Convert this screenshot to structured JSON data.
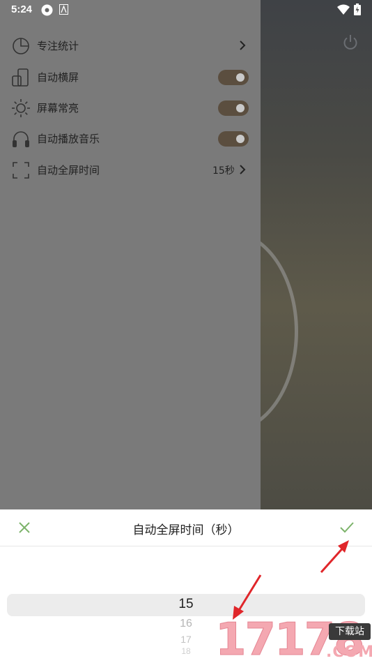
{
  "status_bar": {
    "time": "5:24"
  },
  "menu": {
    "items": [
      {
        "label": "专注统计",
        "icon": "pie-chart-icon",
        "control": "chevron"
      },
      {
        "label": "自动横屏",
        "icon": "rotate-phone-icon",
        "control": "toggle",
        "on": true
      },
      {
        "label": "屏幕常亮",
        "icon": "sun-icon",
        "control": "toggle",
        "on": true
      },
      {
        "label": "自动播放音乐",
        "icon": "headphones-icon",
        "control": "toggle",
        "on": true
      },
      {
        "label": "自动全屏时间",
        "icon": "fullscreen-icon",
        "control": "chevron",
        "value": "15秒"
      }
    ]
  },
  "sheet": {
    "title": "自动全屏时间（秒）",
    "picker": {
      "selected": "15",
      "next": [
        "16",
        "17",
        "18"
      ]
    }
  },
  "watermark": {
    "digits": "17178",
    "badge": "下载站",
    "suffix": ".COM"
  },
  "colors": {
    "toggle_track": "#5b4e3f",
    "accent_green": "#7cb36a",
    "arrow_red": "#e0262a"
  }
}
